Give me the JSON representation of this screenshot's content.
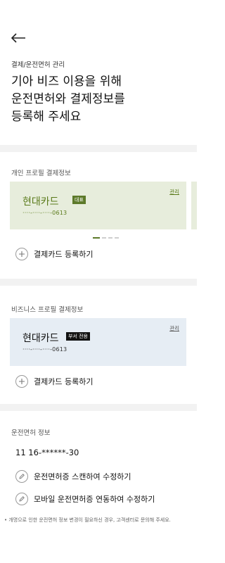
{
  "header": {
    "breadcrumb": "결제/운전면허 관리",
    "title_lines": [
      "기아 비즈 이용을 위해",
      "운전면허와 결제정보를",
      "등록해 주세요"
    ]
  },
  "personal": {
    "section_label": "개인 프로필 결제정보",
    "card": {
      "name": "현대카드",
      "badge": "대표",
      "number": "····-····-····-0613",
      "manage": "관리"
    },
    "carousel": {
      "count": 4,
      "active_index": 0
    },
    "add_card_label": "결제카드 등록하기"
  },
  "business": {
    "section_label": "비즈니스 프로필 결제정보",
    "card": {
      "name": "현대카드",
      "badge": "부서 전용",
      "number": "····-····-····-0613",
      "manage": "관리"
    },
    "add_card_label": "결제카드 등록하기"
  },
  "license": {
    "section_label": "운전면허 정보",
    "number": "11 16-******-30",
    "scan_label": "운전면허증 스캔하여 수정하기",
    "mobile_label": "모바일 운전면허증 연동하여 수정하기",
    "footnote": "• 개명으로 인한 운전면허 정보 변경이 필요하신 경우, 고객센터로 문의해 주세요."
  },
  "colors": {
    "accent_green": "#5d7a2a",
    "personal_card_bg": "#e7eddc",
    "business_card_bg": "#e6edf4",
    "divider": "#f2f2f2"
  },
  "icons": [
    "arrow-left-icon",
    "plus-icon",
    "pencil-icon"
  ]
}
